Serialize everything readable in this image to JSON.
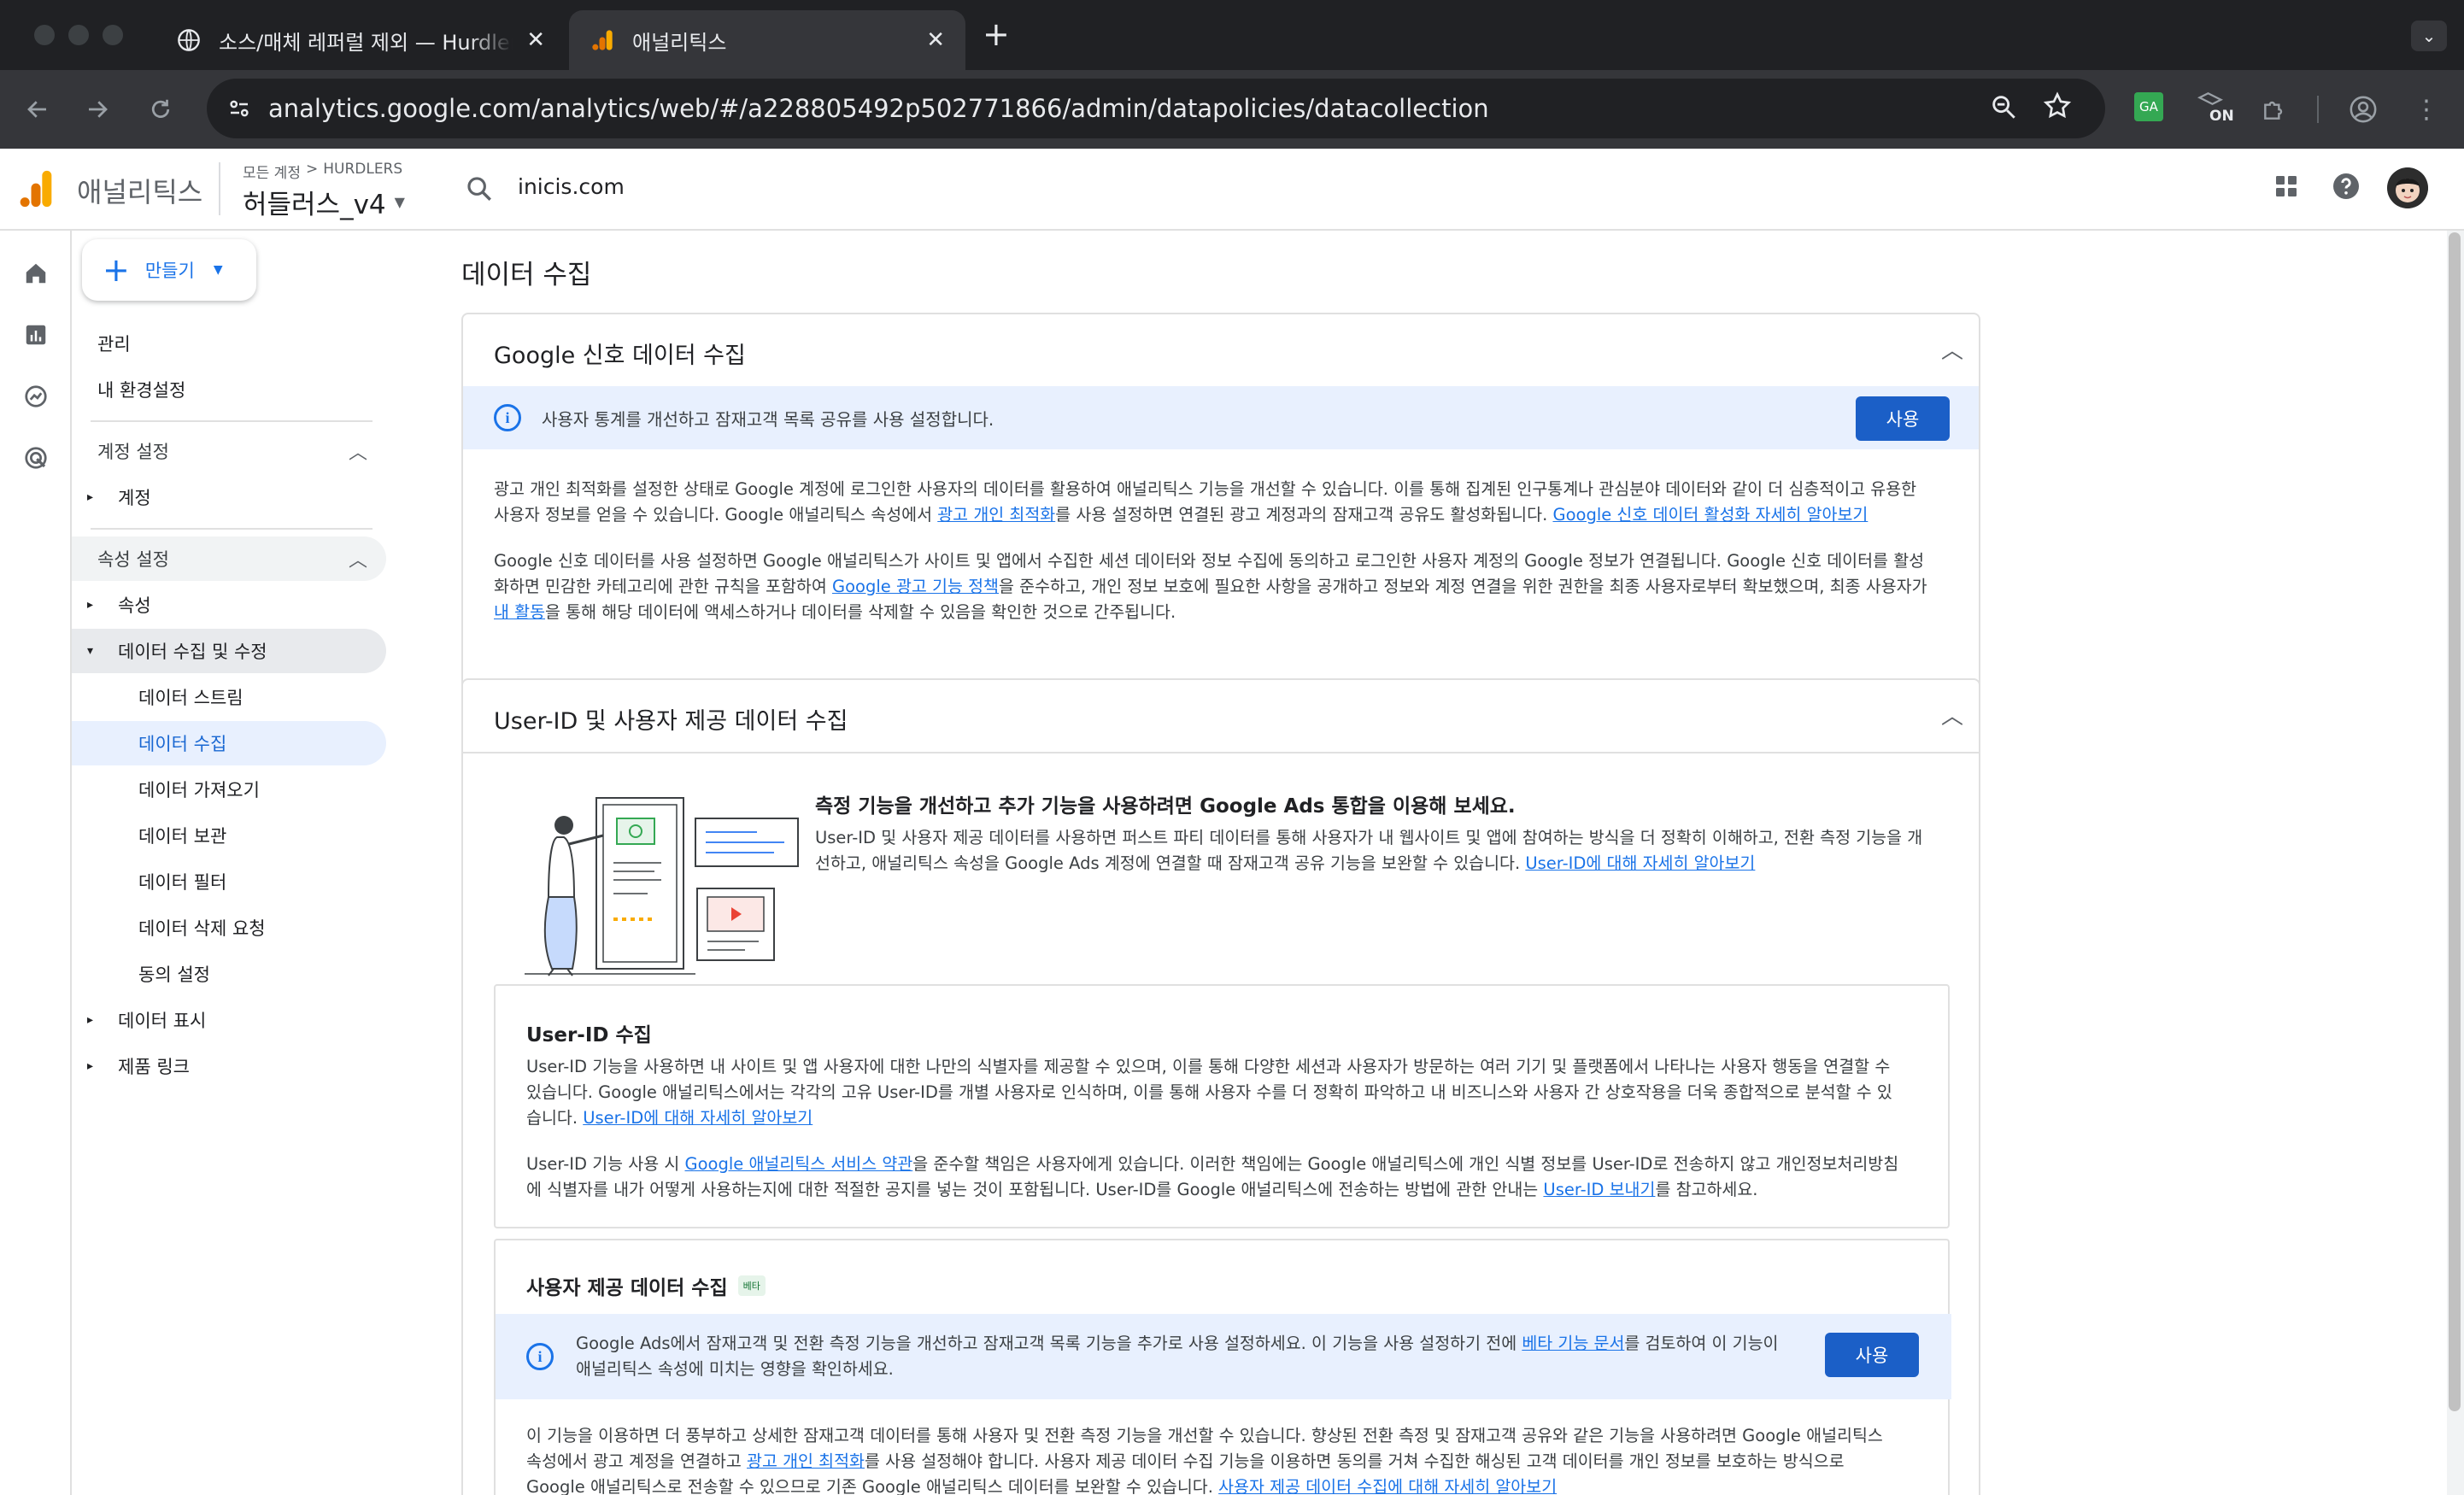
{
  "browser": {
    "tabs": [
      {
        "title": "소스/매체 레퍼럴 제외 — Hurdlers",
        "close": "✕"
      },
      {
        "title": "애널리틱스",
        "close": "✕"
      }
    ],
    "new_tab": "+",
    "url": "analytics.google.com/analytics/web/#/a228805492p502771866/admin/datapolicies/datacollection",
    "ext_on_label": "ON",
    "ext_ga_label": "GA"
  },
  "app": {
    "product_name": "애널리틱스",
    "breadcrumb_all": "모든 계정",
    "breadcrumb_sep": ">",
    "breadcrumb_account": "HURDLERS",
    "property_name": "허들러스_v4",
    "search_value": "inicis.com"
  },
  "sidenav": {
    "create_label": "만들기",
    "admin": "관리",
    "preferences": "내 환경설정",
    "account_settings": "계정 설정",
    "account": "계정",
    "property_settings": "속성 설정",
    "property": "속성",
    "data_collection_modification": "데이터 수집 및 수정",
    "sub": [
      "데이터 스트림",
      "데이터 수집",
      "데이터 가져오기",
      "데이터 보관",
      "데이터 필터",
      "데이터 삭제 요청",
      "동의 설정"
    ],
    "data_display": "데이터 표시",
    "product_links": "제품 링크"
  },
  "main": {
    "page_title": "데이터 수집",
    "signals": {
      "title": "Google 신호 데이터 수집",
      "info": "사용자 통계를 개선하고 잠재고객 목록 공유를 사용 설정합니다.",
      "button": "사용",
      "p1a": "광고 개인 최적화를 설정한 상태로 Google 계정에 로그인한 사용자의 데이터를 활용하여 애널리틱스 기능을 개선할 수 있습니다. 이를 통해 집계된 인구통계나 관심분야 데이터와 같이 더 심층적이고 유용한",
      "p1b_pre": "사용자 정보를 얻을 수 있습니다. Google 애널리틱스 속성에서 ",
      "p1b_link": "광고 개인 최적화",
      "p1b_mid": "를 사용 설정하면 연결된 광고 계정과의 잠재고객 공유도 활성화됩니다. ",
      "p1b_link2": "Google 신호 데이터 활성화 자세히 알아보기",
      "p2a": "Google 신호 데이터를 사용 설정하면 Google 애널리틱스가 사이트 및 앱에서 수집한 세션 데이터와 정보 수집에 동의하고 로그인한 사용자 계정의 Google 정보가 연결됩니다. Google 신호 데이터를 활성",
      "p2b_pre": "화하면 민감한 카테고리에 관한 규칙을 포함하여 ",
      "p2b_link": "Google 광고 기능 정책",
      "p2b_post": "을 준수하고, 개인 정보 보호에 필요한 사항을 공개하고 정보와 계정 연결을 위한 권한을 최종 사용자로부터 확보했으며, 최종 사용자가",
      "p2c_link": "내 활동",
      "p2c_post": "을 통해 해당 데이터에 액세스하거나 데이터를 삭제할 수 있음을 확인한 것으로 간주됩니다."
    },
    "userid": {
      "title": "User-ID 및 사용자 제공 데이터 수집",
      "promo_title": "측정 기능을 개선하고 추가 기능을 사용하려면 Google Ads 통합을 이용해 보세요.",
      "promo_a": "User-ID 및 사용자 제공 데이터를 사용하면 퍼스트 파티 데이터를 통해 사용자가 내 웹사이트 및 앱에 참여하는 방식을 더 정확히 이해하고, 전환 측정 기능을 개",
      "promo_b_pre": "선하고, 애널리틱스 속성을 Google Ads 계정에 연결할 때 잠재고객 공유 기능을 보완할 수 있습니다. ",
      "promo_b_link": "User-ID에 대해 자세히 알아보기",
      "uid_title": "User-ID 수집",
      "uid_p1a": "User-ID 기능을 사용하면 내 사이트 및 앱 사용자에 대한 나만의 식별자를 제공할 수 있으며, 이를 통해 다양한 세션과 사용자가 방문하는 여러 기기 및 플랫폼에서 나타나는 사용자 행동을 연결할 수",
      "uid_p1b": "있습니다. Google 애널리틱스에서는 각각의 고유 User-ID를 개별 사용자로 인식하며, 이를 통해 사용자 수를 더 정확히 파악하고 내 비즈니스와 사용자 간 상호작용을 더욱 종합적으로 분석할 수 있",
      "uid_p1c_pre": "습니다. ",
      "uid_p1c_link": "User-ID에 대해 자세히 알아보기",
      "uid_p2a_pre": "User-ID 기능 사용 시 ",
      "uid_p2a_link": "Google 애널리틱스 서비스 약관",
      "uid_p2a_post": "을 준수할 책임은 사용자에게 있습니다. 이러한 책임에는 Google 애널리틱스에 개인 식별 정보를 User-ID로 전송하지 않고 개인정보처리방침",
      "uid_p2b_pre": "에 식별자를 내가 어떻게 사용하는지에 대한 적절한 공지를 넣는 것이 포함됩니다. User-ID를 Google 애널리틱스에 전송하는 방법에 관한 안내는 ",
      "uid_p2b_link": "User-ID 보내기",
      "uid_p2b_post": "를 참고하세요.",
      "upd_title": "사용자 제공 데이터 수집",
      "upd_badge": "베타",
      "upd_info_a_pre": "Google Ads에서 잠재고객 및 전환 측정 기능을 개선하고 잠재고객 목록 기능을 추가로 사용 설정하세요. 이 기능을 사용 설정하기 전에 ",
      "upd_info_a_link": "베타 기능 문서",
      "upd_info_a_post": "를 검토하여 이 기능이",
      "upd_info_b": "애널리틱스 속성에 미치는 영향을 확인하세요.",
      "upd_button": "사용",
      "upd_p_a": "이 기능을 이용하면 더 풍부하고 상세한 잠재고객 데이터를 통해 사용자 및 전환 측정 기능을 개선할 수 있습니다. 향상된 전환 측정 및 잠재고객 공유와 같은 기능을 사용하려면 Google 애널리틱스",
      "upd_p_b_pre": "속성에서 광고 계정을 연결하고 ",
      "upd_p_b_link": "광고 개인 최적화",
      "upd_p_b_post": "를 사용 설정해야 합니다. 사용자 제공 데이터 수집 기능을 이용하면 동의를 거쳐 수집한 해싱된 고객 데이터를 개인 정보를 보호하는 방식으로",
      "upd_p_c_pre": "Google 애널리틱스로 전송할 수 있으므로 기존 Google 애널리틱스 데이터를 보완할 수 있습니다. ",
      "upd_p_c_link": "사용자 제공 데이터 수집에 대해 자세히 알아보기"
    }
  },
  "colors": {
    "accent": "#1a73e8",
    "button": "#1b5fc7",
    "info_bg": "#e8f0fe",
    "ga_orange": "#f9ab00",
    "ga_dark": "#e37400"
  }
}
